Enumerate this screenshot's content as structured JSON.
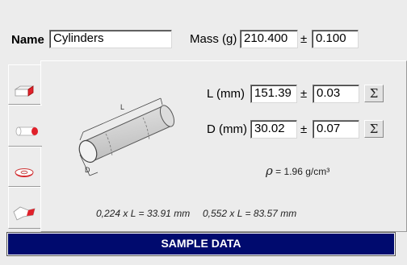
{
  "name": {
    "label": "Name",
    "value": "Cylinders"
  },
  "mass": {
    "label": "Mass (g)",
    "value": "210.400",
    "pm": "±",
    "uncertainty": "0.100"
  },
  "length": {
    "label": "L (mm)",
    "value": "151.39",
    "pm": "±",
    "uncertainty": "0.03",
    "sigma": "Σ"
  },
  "diameter": {
    "label": "D (mm)",
    "value": "30.02",
    "pm": "±",
    "uncertainty": "0.07",
    "sigma": "Σ"
  },
  "density": {
    "symbol": "ρ",
    "text": "= 1.96 g/cm³"
  },
  "formulas": {
    "first": "0,224 x L  = 33.91 mm",
    "second": "0,552 x L = 83.57 mm"
  },
  "diagram": {
    "length_label": "L",
    "diameter_label": "D"
  },
  "tabs": [
    {
      "icon": "prism-icon"
    },
    {
      "icon": "cylinder-icon",
      "active": true
    },
    {
      "icon": "ring-icon"
    },
    {
      "icon": "irregular-shape-icon"
    }
  ],
  "footer": {
    "title": "SAMPLE DATA"
  },
  "colors": {
    "footer_bg": "#000a6e",
    "window_bg": "#ececec",
    "icon_red": "#e0202a"
  }
}
